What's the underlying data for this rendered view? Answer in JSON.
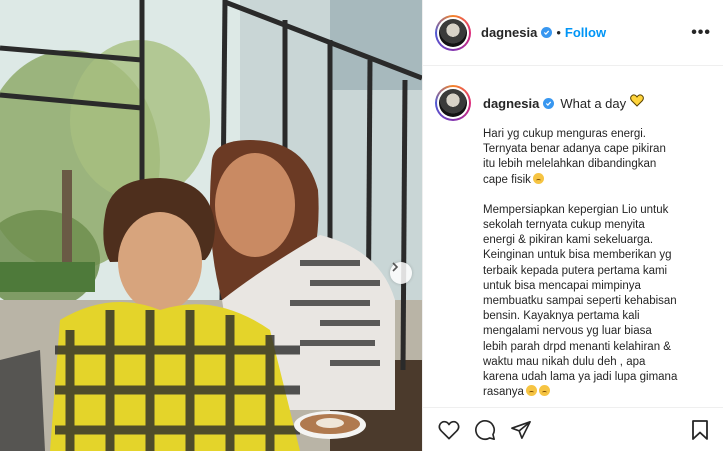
{
  "post": {
    "username": "dagnesia",
    "verified": true,
    "follow_label": "Follow",
    "separator": "•",
    "more_label": "•••",
    "caption_title": "What a day",
    "caption_paragraphs": [
      "Hari yg cukup menguras energi.\nTernyata benar adanya cape pikiran\nitu lebih melelahkan dibandingkan\ncape fisik",
      "Mempersiapkan kepergian Lio untuk\nsekolah ternyata cukup menyita\nenergi & pikiran kami sekeluarga.\nKeinginan untuk bisa memberikan yg\nterbaik kepada putera pertama kami\nuntuk bisa mencapai mimpinya\nmembuatku sampai seperti kehabisan\nbensin. Kayaknya pertama kali\nmengalami nervous yg luar biasa\nlebih parah drpd menanti kelahiran &\nwaktu mau nikah dulu deh , apa\nkarena udah lama ya jadi lupa gimana\nrasanya"
    ],
    "icons": {
      "verified": "verified-badge-icon",
      "heart_emoji": "yellow-heart-emoji",
      "like": "heart-icon",
      "comment": "comment-icon",
      "share": "share-icon",
      "save": "bookmark-icon",
      "next": "chevron-right-icon"
    }
  },
  "colors": {
    "accent": "#0095f6",
    "verified": "#3897f0",
    "text": "#262626",
    "border": "#efefef"
  }
}
